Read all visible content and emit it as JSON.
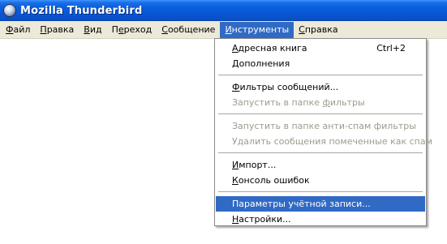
{
  "window": {
    "title": "Mozilla Thunderbird"
  },
  "menubar": {
    "items": [
      {
        "pre": "",
        "key": "Ф",
        "post": "айл"
      },
      {
        "pre": "",
        "key": "П",
        "post": "равка"
      },
      {
        "pre": "",
        "key": "В",
        "post": "ид"
      },
      {
        "pre": "П",
        "key": "е",
        "post": "реход"
      },
      {
        "pre": "",
        "key": "С",
        "post": "ообщение"
      },
      {
        "pre": "",
        "key": "И",
        "post": "нструменты"
      },
      {
        "pre": "",
        "key": "С",
        "post": "правка"
      }
    ],
    "active_index": 5
  },
  "tools_menu": {
    "address_book": {
      "pre": "",
      "key": "А",
      "post": "дресная книга",
      "shortcut": "Ctrl+2"
    },
    "addons": {
      "pre": "",
      "key": "Д",
      "post": "ополнения"
    },
    "message_filters": {
      "pre": "",
      "key": "Ф",
      "post": "ильтры сообщений..."
    },
    "run_filters": {
      "pre": "Запустить в папке ",
      "key": "ф",
      "post": "ильтры"
    },
    "run_junk": {
      "pre": "Запустить в папке анти-спам фильтры",
      "key": "",
      "post": ""
    },
    "delete_junk": {
      "pre": "Удалить сообщения помеченные как спам",
      "key": "",
      "post": ""
    },
    "import": {
      "pre": "",
      "key": "И",
      "post": "мпорт..."
    },
    "error_console": {
      "pre": "",
      "key": "К",
      "post": "онсоль ошибок"
    },
    "account_settings": {
      "pre": "Параметры учётной записи...",
      "key": "",
      "post": ""
    },
    "options": {
      "pre": "",
      "key": "Н",
      "post": "астройки..."
    }
  }
}
